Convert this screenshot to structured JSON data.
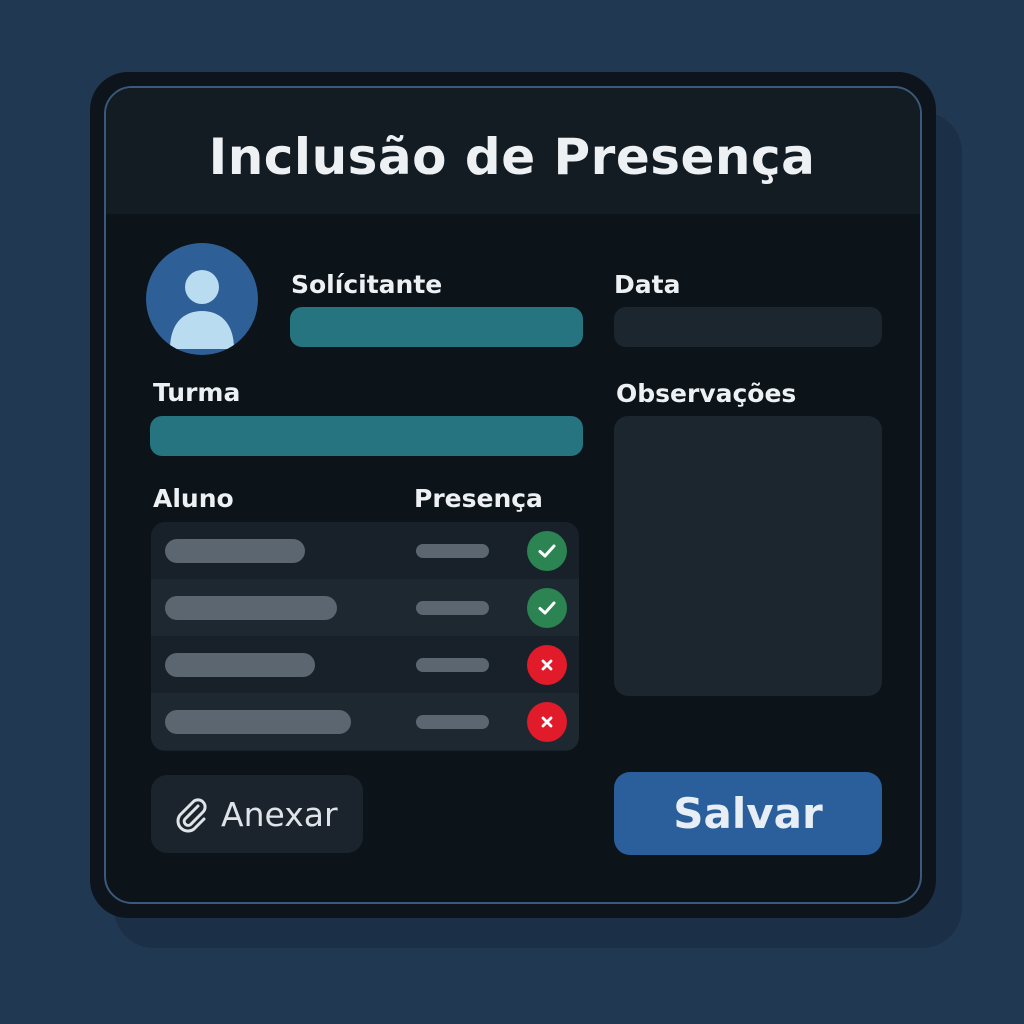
{
  "title": "Inclusão de Presença",
  "form": {
    "requester_label": "Solícitante",
    "date_label": "Data",
    "class_label": "Turma",
    "notes_label": "Observações"
  },
  "table": {
    "headers": [
      "Aluno",
      "Presença"
    ],
    "rows": [
      {
        "status": "present",
        "icon": "check-icon"
      },
      {
        "status": "present",
        "icon": "check-icon"
      },
      {
        "status": "absent",
        "icon": "x-icon"
      },
      {
        "status": "absent",
        "icon": "x-icon"
      }
    ]
  },
  "actions": {
    "attach_label": "Anexar",
    "attach_icon": "paperclip-icon",
    "save_label": "Salvar"
  },
  "colors": {
    "accent_teal": "#267480",
    "primary_blue": "#2a5f9b",
    "present_green": "#2b8452",
    "absent_red": "#e11b2a"
  }
}
